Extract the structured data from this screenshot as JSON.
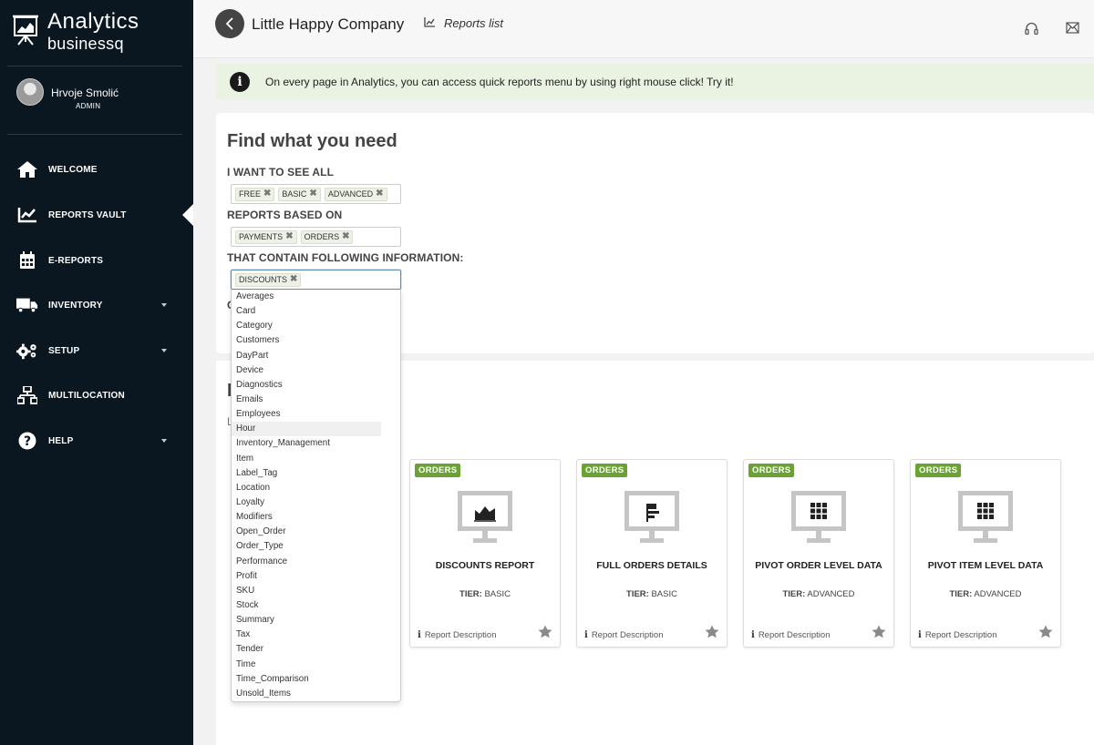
{
  "brand": {
    "title": "Analytics",
    "subtitle": "businessq"
  },
  "user": {
    "name": "Hrvoje Smolić",
    "role": "ADMIN"
  },
  "nav": [
    {
      "label": "WELCOME",
      "icon": "home-icon"
    },
    {
      "label": "REPORTS VAULT",
      "icon": "chart-line-icon"
    },
    {
      "label": "E-REPORTS",
      "icon": "calendar-icon"
    },
    {
      "label": "INVENTORY",
      "icon": "truck-icon"
    },
    {
      "label": "SETUP",
      "icon": "gears-icon"
    },
    {
      "label": "MULTILOCATION",
      "icon": "sitemap-icon"
    },
    {
      "label": "HELP",
      "icon": "question-circle-icon"
    }
  ],
  "header": {
    "company": "Little Happy Company",
    "breadcrumb": "Reports list"
  },
  "notice": {
    "text": "On every page in Analytics, you can access quick reports menu by using right mouse click! Try it!"
  },
  "filters": {
    "title": "Find what you need",
    "see_all_label": "I WANT TO SEE ALL",
    "see_all_tags": [
      "FREE",
      "BASIC",
      "ADVANCED"
    ],
    "based_on_label": "REPORTS BASED ON",
    "based_on_tags": [
      "PAYMENTS",
      "ORDERS"
    ],
    "contain_label": "THAT CONTAIN FOLLOWING INFORMATION:",
    "contain_tags": [
      "DISCOUNTS"
    ],
    "hidden_label_fragment": "C"
  },
  "results": {
    "title_fragment": "I",
    "subtitle_fragment": "L"
  },
  "dropdown": {
    "options": [
      "Averages",
      "Card",
      "Category",
      "Customers",
      "DayPart",
      "Device",
      "Diagnostics",
      "Emails",
      "Employees",
      "Hour",
      "Inventory_Management",
      "Item",
      "Label_Tag",
      "Location",
      "Loyalty",
      "Modifiers",
      "Open_Order",
      "Order_Type",
      "Performance",
      "Profit",
      "SKU",
      "Stock",
      "Summary",
      "Tax",
      "Tender",
      "Time",
      "Time_Comparison",
      "Unsold_Items"
    ],
    "highlighted": "Hour"
  },
  "tier_prefix": "TIER:",
  "cards": [
    {
      "badge": "ORDERS",
      "title": "DISCOUNTS REPORT",
      "tier": "BASIC",
      "desc": "Report Description",
      "icon": "area-chart-icon"
    },
    {
      "badge": "ORDERS",
      "title": "FULL ORDERS DETAILS",
      "tier": "BASIC",
      "desc": "Report Description",
      "icon": "flag-list-icon"
    },
    {
      "badge": "ORDERS",
      "title": "PIVOT ORDER LEVEL DATA",
      "tier": "ADVANCED",
      "desc": "Report Description",
      "icon": "grid-icon"
    },
    {
      "badge": "ORDERS",
      "title": "PIVOT ITEM LEVEL DATA",
      "tier": "ADVANCED",
      "desc": "Report Description",
      "icon": "grid-icon"
    }
  ],
  "colors": {
    "sidebar": "#0a1620",
    "badge": "#6aa334",
    "notice_bg": "#eaf3e2"
  }
}
